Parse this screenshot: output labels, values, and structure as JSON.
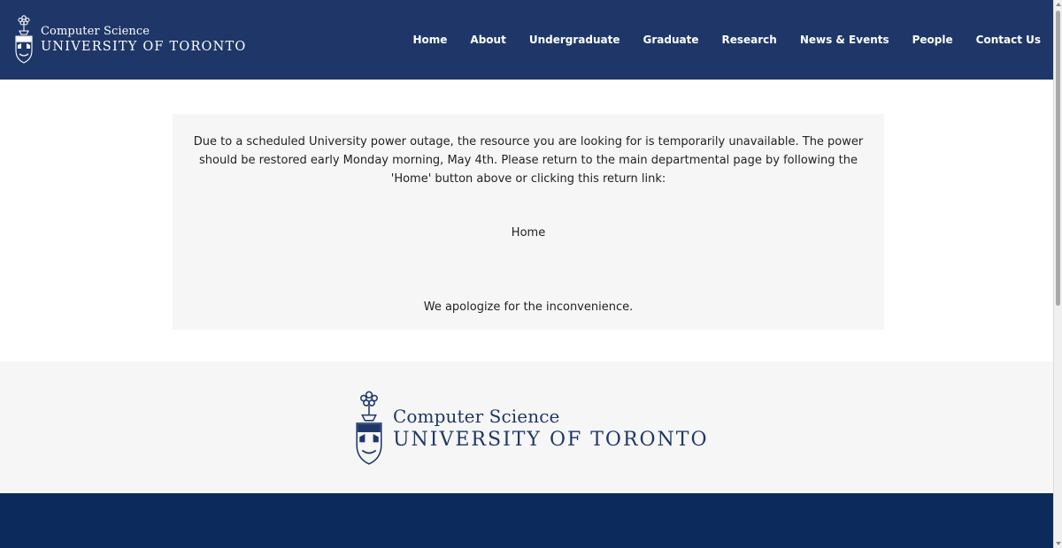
{
  "header": {
    "logo": {
      "department": "Computer Science",
      "university": "UNIVERSITY OF TORONTO",
      "crest_icon": "uoft-crest-icon"
    },
    "nav": [
      {
        "label": "Home"
      },
      {
        "label": "About"
      },
      {
        "label": "Undergraduate"
      },
      {
        "label": "Graduate"
      },
      {
        "label": "Research"
      },
      {
        "label": "News & Events"
      },
      {
        "label": "People"
      },
      {
        "label": "Contact Us"
      }
    ]
  },
  "notice": {
    "message": "Due to a scheduled University power outage, the resource you are looking for is temporarily unavailable. The power should be restored early Monday morning, May 4th. Please return to the main departmental page by following the 'Home' button above or clicking this return link:",
    "home_link": "Home",
    "apology": "We apologize for the inconvenience."
  },
  "footer": {
    "logo": {
      "department": "Computer Science",
      "university": "UNIVERSITY OF TORONTO",
      "crest_icon": "uoft-crest-icon"
    }
  },
  "colors": {
    "header_bg": "#1f3768",
    "footer_dark_bg": "#0c2b5c",
    "panel_bg": "#f6f6f6",
    "logo_text_dark": "#1f3768"
  }
}
